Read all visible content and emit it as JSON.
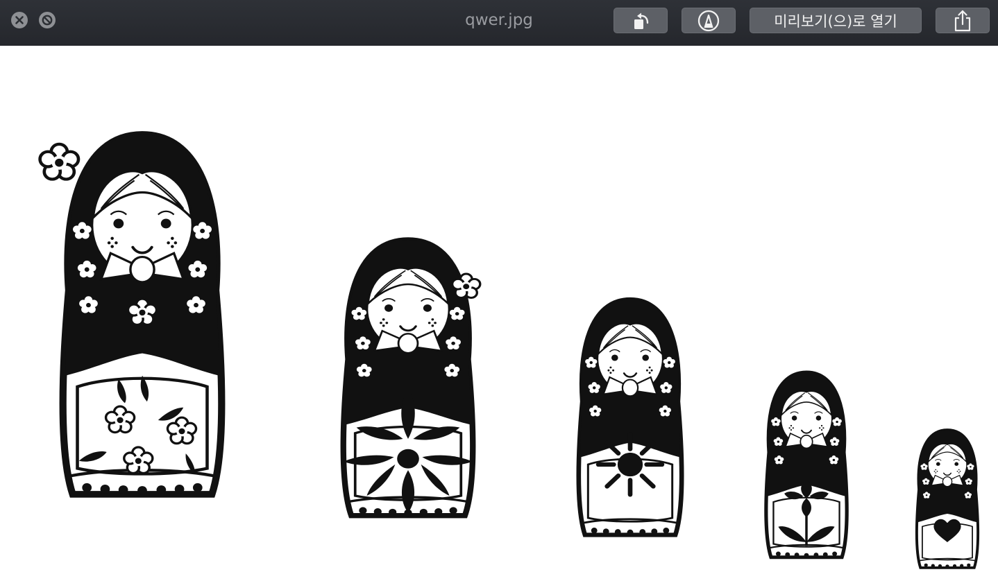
{
  "window": {
    "title": "qwer.jpg"
  },
  "toolbar": {
    "close_icon": "close-icon",
    "fullscreen_icon": "no-entry-icon",
    "rotate_icon": "rotate-left-icon",
    "markup_icon": "markup-pen-icon",
    "open_with_preview_label": "미리보기(으)로 열기",
    "share_icon": "share-icon"
  },
  "image": {
    "subject": "matryoshka-dolls",
    "doll_count": 5
  },
  "colors": {
    "titlebar": "#2b2e33",
    "title_text": "#9a9ca1",
    "button_bg": "#5d6066",
    "ink": "#111111"
  }
}
